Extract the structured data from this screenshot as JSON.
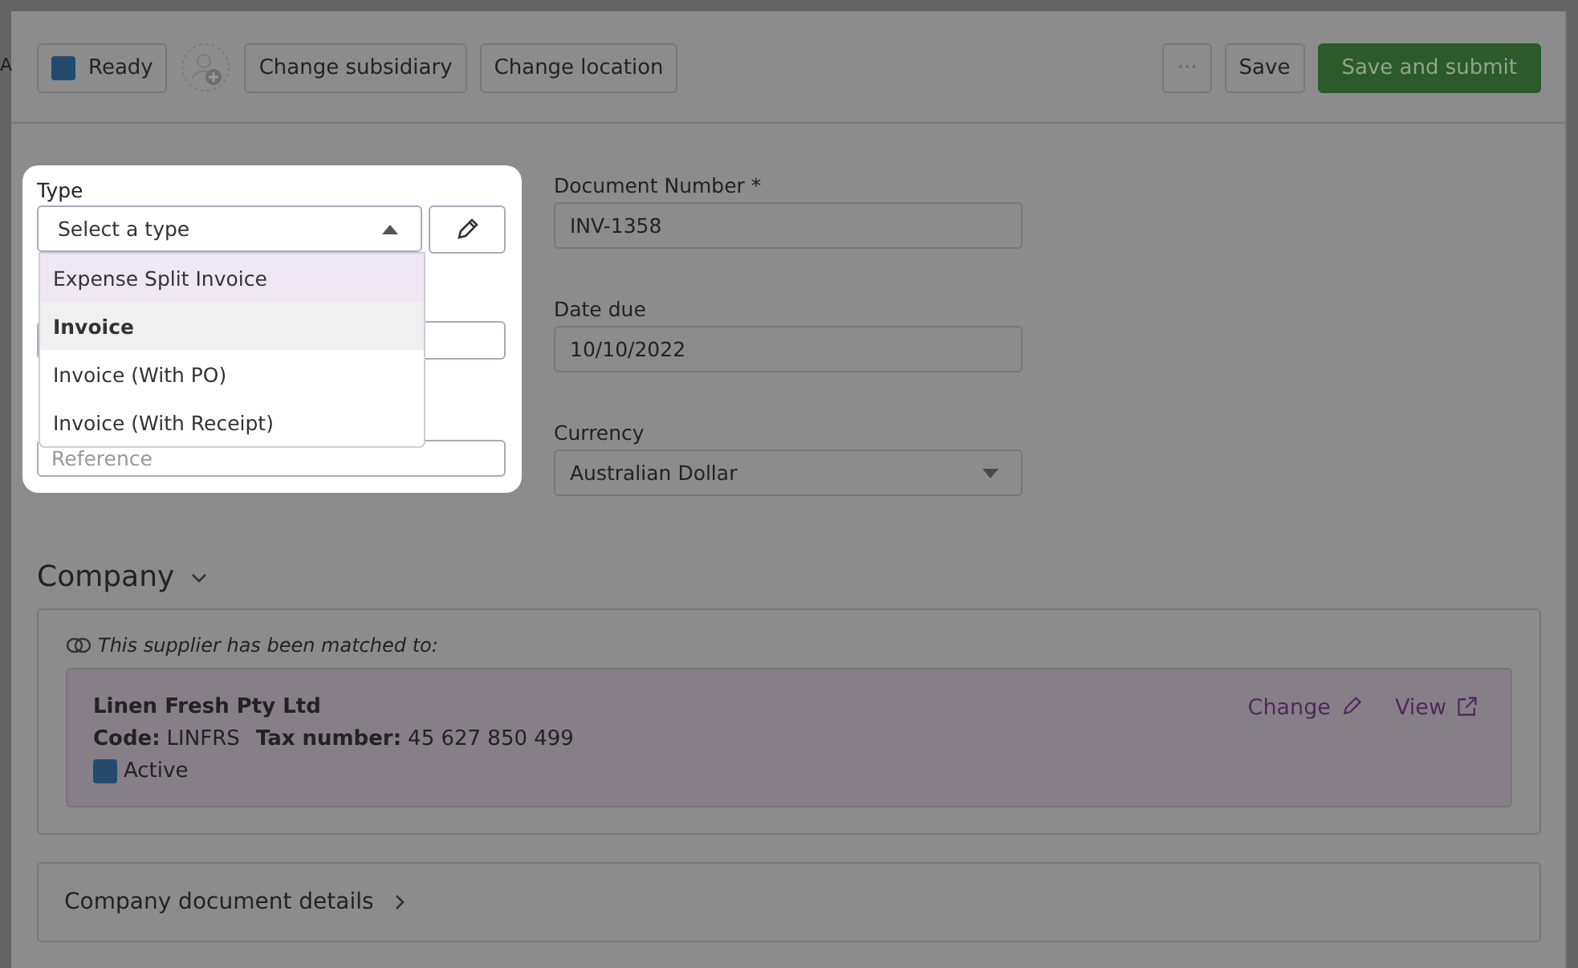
{
  "edge_text": "A",
  "toolbar": {
    "status": {
      "label": "Ready"
    },
    "left_buttons": [
      "Change subsidiary",
      "Change location"
    ],
    "more": "···",
    "save": "Save",
    "submit": "Save and submit"
  },
  "type_field": {
    "label": "Type",
    "placeholder": "Select a type",
    "expanded": true,
    "options": [
      {
        "label": "Expense Split Invoice",
        "hovered": true,
        "selected": false
      },
      {
        "label": "Invoice",
        "hovered": false,
        "selected": true
      },
      {
        "label": "Invoice (With PO)",
        "hovered": false,
        "selected": false
      },
      {
        "label": "Invoice (With Receipt)",
        "hovered": false,
        "selected": false
      }
    ]
  },
  "reference_field": {
    "placeholder": "Reference"
  },
  "document_number": {
    "label": "Document Number *",
    "value": "INV-1358"
  },
  "date_due": {
    "label": "Date due",
    "value": "10/10/2022"
  },
  "currency": {
    "label": "Currency",
    "value": "Australian Dollar"
  },
  "company": {
    "title": "Company",
    "expanded": true,
    "match_note": "This supplier has been matched to:",
    "supplier": {
      "name": "Linen Fresh Pty Ltd",
      "code_label": "Code:",
      "code": "LINFRS",
      "tax_label": "Tax number:",
      "tax": "45 627 850 499",
      "status": "Active"
    },
    "actions": [
      "Change",
      "View"
    ]
  },
  "details": {
    "title": "Company document details",
    "expanded": false
  }
}
